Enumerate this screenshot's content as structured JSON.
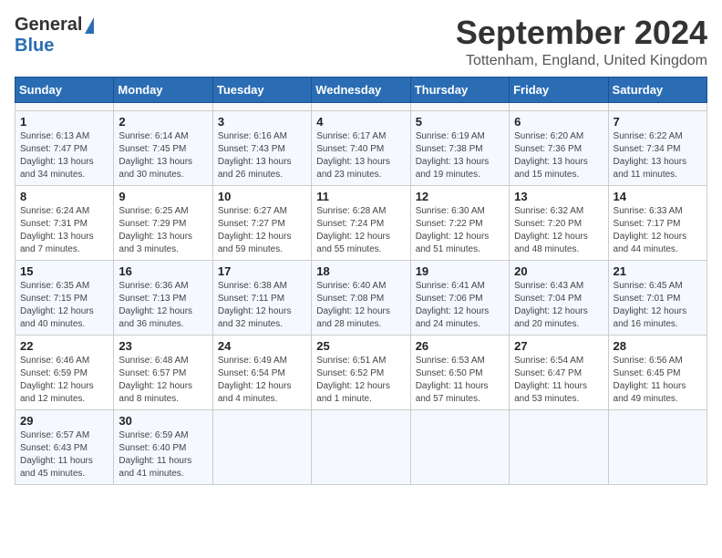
{
  "header": {
    "logo_general": "General",
    "logo_blue": "Blue",
    "month_title": "September 2024",
    "location": "Tottenham, England, United Kingdom"
  },
  "calendar": {
    "days_of_week": [
      "Sunday",
      "Monday",
      "Tuesday",
      "Wednesday",
      "Thursday",
      "Friday",
      "Saturday"
    ],
    "weeks": [
      [
        {
          "day": null,
          "info": null
        },
        {
          "day": null,
          "info": null
        },
        {
          "day": null,
          "info": null
        },
        {
          "day": null,
          "info": null
        },
        {
          "day": null,
          "info": null
        },
        {
          "day": null,
          "info": null
        },
        {
          "day": null,
          "info": null
        }
      ],
      [
        {
          "day": "1",
          "info": "Sunrise: 6:13 AM\nSunset: 7:47 PM\nDaylight: 13 hours\nand 34 minutes."
        },
        {
          "day": "2",
          "info": "Sunrise: 6:14 AM\nSunset: 7:45 PM\nDaylight: 13 hours\nand 30 minutes."
        },
        {
          "day": "3",
          "info": "Sunrise: 6:16 AM\nSunset: 7:43 PM\nDaylight: 13 hours\nand 26 minutes."
        },
        {
          "day": "4",
          "info": "Sunrise: 6:17 AM\nSunset: 7:40 PM\nDaylight: 13 hours\nand 23 minutes."
        },
        {
          "day": "5",
          "info": "Sunrise: 6:19 AM\nSunset: 7:38 PM\nDaylight: 13 hours\nand 19 minutes."
        },
        {
          "day": "6",
          "info": "Sunrise: 6:20 AM\nSunset: 7:36 PM\nDaylight: 13 hours\nand 15 minutes."
        },
        {
          "day": "7",
          "info": "Sunrise: 6:22 AM\nSunset: 7:34 PM\nDaylight: 13 hours\nand 11 minutes."
        }
      ],
      [
        {
          "day": "8",
          "info": "Sunrise: 6:24 AM\nSunset: 7:31 PM\nDaylight: 13 hours\nand 7 minutes."
        },
        {
          "day": "9",
          "info": "Sunrise: 6:25 AM\nSunset: 7:29 PM\nDaylight: 13 hours\nand 3 minutes."
        },
        {
          "day": "10",
          "info": "Sunrise: 6:27 AM\nSunset: 7:27 PM\nDaylight: 12 hours\nand 59 minutes."
        },
        {
          "day": "11",
          "info": "Sunrise: 6:28 AM\nSunset: 7:24 PM\nDaylight: 12 hours\nand 55 minutes."
        },
        {
          "day": "12",
          "info": "Sunrise: 6:30 AM\nSunset: 7:22 PM\nDaylight: 12 hours\nand 51 minutes."
        },
        {
          "day": "13",
          "info": "Sunrise: 6:32 AM\nSunset: 7:20 PM\nDaylight: 12 hours\nand 48 minutes."
        },
        {
          "day": "14",
          "info": "Sunrise: 6:33 AM\nSunset: 7:17 PM\nDaylight: 12 hours\nand 44 minutes."
        }
      ],
      [
        {
          "day": "15",
          "info": "Sunrise: 6:35 AM\nSunset: 7:15 PM\nDaylight: 12 hours\nand 40 minutes."
        },
        {
          "day": "16",
          "info": "Sunrise: 6:36 AM\nSunset: 7:13 PM\nDaylight: 12 hours\nand 36 minutes."
        },
        {
          "day": "17",
          "info": "Sunrise: 6:38 AM\nSunset: 7:11 PM\nDaylight: 12 hours\nand 32 minutes."
        },
        {
          "day": "18",
          "info": "Sunrise: 6:40 AM\nSunset: 7:08 PM\nDaylight: 12 hours\nand 28 minutes."
        },
        {
          "day": "19",
          "info": "Sunrise: 6:41 AM\nSunset: 7:06 PM\nDaylight: 12 hours\nand 24 minutes."
        },
        {
          "day": "20",
          "info": "Sunrise: 6:43 AM\nSunset: 7:04 PM\nDaylight: 12 hours\nand 20 minutes."
        },
        {
          "day": "21",
          "info": "Sunrise: 6:45 AM\nSunset: 7:01 PM\nDaylight: 12 hours\nand 16 minutes."
        }
      ],
      [
        {
          "day": "22",
          "info": "Sunrise: 6:46 AM\nSunset: 6:59 PM\nDaylight: 12 hours\nand 12 minutes."
        },
        {
          "day": "23",
          "info": "Sunrise: 6:48 AM\nSunset: 6:57 PM\nDaylight: 12 hours\nand 8 minutes."
        },
        {
          "day": "24",
          "info": "Sunrise: 6:49 AM\nSunset: 6:54 PM\nDaylight: 12 hours\nand 4 minutes."
        },
        {
          "day": "25",
          "info": "Sunrise: 6:51 AM\nSunset: 6:52 PM\nDaylight: 12 hours\nand 1 minute."
        },
        {
          "day": "26",
          "info": "Sunrise: 6:53 AM\nSunset: 6:50 PM\nDaylight: 11 hours\nand 57 minutes."
        },
        {
          "day": "27",
          "info": "Sunrise: 6:54 AM\nSunset: 6:47 PM\nDaylight: 11 hours\nand 53 minutes."
        },
        {
          "day": "28",
          "info": "Sunrise: 6:56 AM\nSunset: 6:45 PM\nDaylight: 11 hours\nand 49 minutes."
        }
      ],
      [
        {
          "day": "29",
          "info": "Sunrise: 6:57 AM\nSunset: 6:43 PM\nDaylight: 11 hours\nand 45 minutes."
        },
        {
          "day": "30",
          "info": "Sunrise: 6:59 AM\nSunset: 6:40 PM\nDaylight: 11 hours\nand 41 minutes."
        },
        {
          "day": null,
          "info": null
        },
        {
          "day": null,
          "info": null
        },
        {
          "day": null,
          "info": null
        },
        {
          "day": null,
          "info": null
        },
        {
          "day": null,
          "info": null
        }
      ]
    ]
  }
}
